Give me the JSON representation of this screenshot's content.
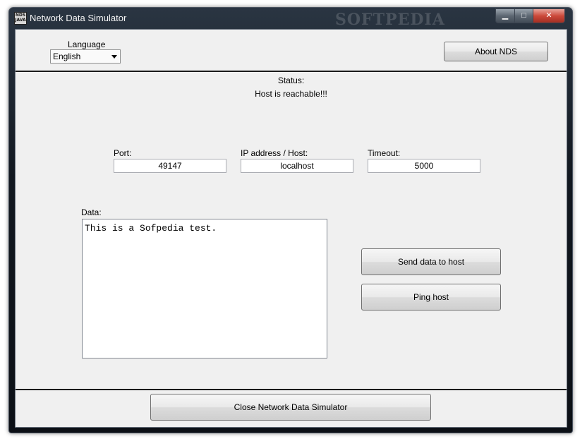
{
  "window": {
    "title": "Network Data Simulator",
    "icon_text": "NDS\nJAVA",
    "watermark": "SOFTPEDIA",
    "controls": {
      "minimize": "▁",
      "maximize": "□",
      "close": "✕"
    }
  },
  "language": {
    "label": "Language",
    "selected": "English"
  },
  "about_button": "About NDS",
  "status": {
    "label": "Status:",
    "text": "Host is reachable!!!"
  },
  "fields": {
    "port": {
      "label": "Port:",
      "value": "49147"
    },
    "host": {
      "label": "IP address / Host:",
      "value": "localhost"
    },
    "timeout": {
      "label": "Timeout:",
      "value": "5000"
    }
  },
  "data": {
    "label": "Data:",
    "value": "This is a Sofpedia test."
  },
  "buttons": {
    "send": "Send data to host",
    "ping": "Ping host",
    "close": "Close Network Data Simulator"
  },
  "icons": {
    "app": "nds-app-icon",
    "dropdown": "chevron-down-icon"
  },
  "colors": {
    "client_bg": "#f0f0f0",
    "close_button": "#cc4a3b",
    "frame": "#121820"
  }
}
